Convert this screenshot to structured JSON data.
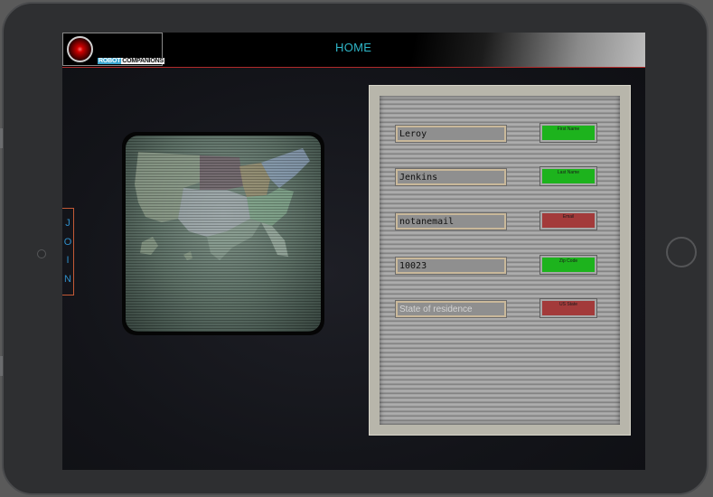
{
  "brand": {
    "logo_part1": "ROBOT",
    "logo_part2": "COMPANIONS"
  },
  "header": {
    "home_label": "HOME"
  },
  "side_tab": {
    "letters": [
      "J",
      "O",
      "I",
      "N"
    ]
  },
  "form": {
    "fields": [
      {
        "value": "Leroy",
        "placeholder": "",
        "tag": "First Name",
        "status": "ok"
      },
      {
        "value": "Jenkins",
        "placeholder": "",
        "tag": "Last Name",
        "status": "ok"
      },
      {
        "value": "notanemail",
        "placeholder": "",
        "tag": "Email",
        "status": "bad"
      },
      {
        "value": "10023",
        "placeholder": "",
        "tag": "Zip Code",
        "status": "ok"
      },
      {
        "value": "",
        "placeholder": "State of residence",
        "tag": "US State",
        "status": "bad"
      }
    ]
  },
  "colors": {
    "accent_text": "#2eb6c8",
    "valid": "#1db31d",
    "invalid": "#a33a3a",
    "join_border": "#c45a36"
  },
  "icons": {
    "logo": "red-eye-icon",
    "map": "us-map-icon"
  }
}
